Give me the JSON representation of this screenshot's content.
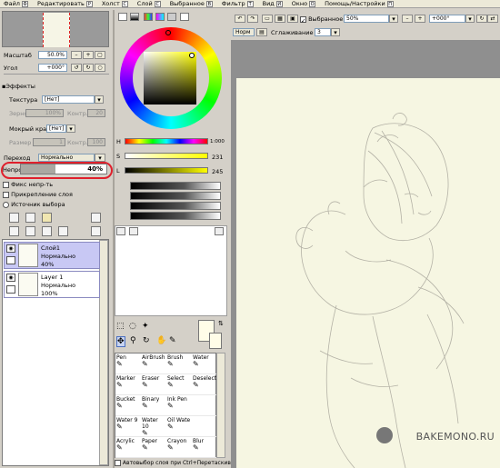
{
  "menubar": {
    "items": [
      {
        "label": "Файл",
        "key": "Ф"
      },
      {
        "label": "Редактировать",
        "key": "Р"
      },
      {
        "label": "Холст",
        "key": "С"
      },
      {
        "label": "Слой",
        "key": "С"
      },
      {
        "label": "Выбранное",
        "key": "В"
      },
      {
        "label": "Фильтр",
        "key": "Т"
      },
      {
        "label": "Вид",
        "key": "И"
      },
      {
        "label": "Окно",
        "key": "О"
      },
      {
        "label": "Помощь/Настройки",
        "key": "П"
      }
    ]
  },
  "navigator": {
    "zoom_label": "Масштаб",
    "zoom_value": "50.0%",
    "angle_label": "Угол",
    "angle_value": "+000°"
  },
  "effects": {
    "title": "Эффекты",
    "texture_label": "Текстура",
    "texture_value": "[Нет]",
    "grain_label": "Зерно",
    "grain_value": "100%",
    "contrast_label": "Контр.",
    "contrast_value": "20",
    "wet_edge_label": "Мокрый край",
    "wet_edge_value": "[Нет]",
    "size_label": "Размер",
    "size_value": "1",
    "contrast2_label": "Контр.",
    "contrast2_value": "100"
  },
  "layer_props": {
    "blend_label": "Переход",
    "blend_value": "Нормально",
    "opacity_label": "Непроз-ть",
    "opacity_value": "40%",
    "opacity_fraction": 0.4,
    "preserve_opacity": "Фикс непр-ть",
    "clip_layer": "Прикрепление слоя",
    "selection_source": "Источник выбора"
  },
  "layers": [
    {
      "name": "Слой1",
      "mode": "Нормально",
      "opacity": "40%",
      "selected": true
    },
    {
      "name": "Layer 1",
      "mode": "Нормально",
      "opacity": "100%",
      "selected": false
    }
  ],
  "color": {
    "h_label": "H",
    "h_value": "1:000",
    "s_label": "S",
    "s_value": "231",
    "v_label": "L",
    "v_value": "245"
  },
  "tools": [
    {
      "name": "Pen",
      "icon": "pen-icon"
    },
    {
      "name": "AirBrush",
      "icon": "airbrush-icon"
    },
    {
      "name": "Brush",
      "icon": "brush-icon"
    },
    {
      "name": "Water",
      "icon": "water-icon"
    },
    {
      "name": "Marker",
      "icon": "marker-icon"
    },
    {
      "name": "Eraser",
      "icon": "eraser-icon"
    },
    {
      "name": "Select",
      "icon": "select-icon"
    },
    {
      "name": "Deselect",
      "icon": "deselect-icon"
    },
    {
      "name": "Bucket",
      "icon": "bucket-icon"
    },
    {
      "name": "Binary",
      "icon": "binary-icon"
    },
    {
      "name": "Ink Pen",
      "icon": "ink-pen-icon"
    },
    {
      "name": "",
      "icon": ""
    },
    {
      "name": "Water 9",
      "icon": "water-icon"
    },
    {
      "name": "Water 10",
      "icon": "water-icon"
    },
    {
      "name": "Oil Wate",
      "icon": "oil-water-icon"
    },
    {
      "name": "",
      "icon": ""
    },
    {
      "name": "Acrylic",
      "icon": "acrylic-icon"
    },
    {
      "name": "Paper",
      "icon": "paper-icon"
    },
    {
      "name": "Crayon",
      "icon": "crayon-icon"
    },
    {
      "name": "Blur",
      "icon": "blur-icon"
    }
  ],
  "auto_select": "Автовыбор слоя при Ctrl+Перетаскивании",
  "toolbar": {
    "selection_label": "Выбранное",
    "zoom_value": "50%",
    "angle_value": "+000°",
    "mode_value": "Норм",
    "smoothing_label": "Сглаживание",
    "smoothing_value": "3"
  },
  "watermark": "BAKEMONO.RU"
}
